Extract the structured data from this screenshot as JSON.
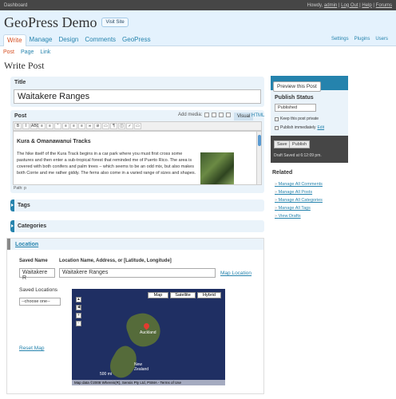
{
  "topbar": {
    "left": "Dashboard",
    "howdy": "Howdy,",
    "user": "admin",
    "links": [
      "Log Out",
      "Help",
      "Forums"
    ]
  },
  "header": {
    "site_title": "GeoPress Demo",
    "visit_site": "Visit Site"
  },
  "menu": {
    "main": [
      "Write",
      "Manage",
      "Design",
      "Comments",
      "GeoPress"
    ],
    "secondary": [
      "Settings",
      "Plugins",
      "Users"
    ]
  },
  "submenu": [
    "Post",
    "Page",
    "Link"
  ],
  "page_title": "Write Post",
  "title_box": {
    "label": "Title",
    "value": "Waitakere Ranges"
  },
  "post_box": {
    "label": "Post",
    "add_media": "Add media:",
    "tab_visual": "Visual",
    "tab_html": "HTML",
    "toolbar": [
      "B",
      "I",
      "ABC",
      "≡",
      "≡",
      "“",
      "≡",
      "≡",
      "≡",
      "∞",
      "⊘",
      "▭",
      "¶",
      "◫",
      "✓",
      "▭"
    ],
    "heading": "Kura & Omanawanui Tracks",
    "body": "The hike itself of the Kura Track begins in a car park where you must first cross some pastures and then enter a sub-tropical forest that reminded me of Puerto Rico. The area is covered with both conifers and palm trees – which seems to be an odd mix, but also makes both Corrie and me rather giddy. The ferns also come in a varied range of sizes and shapes.",
    "path": "Path: p"
  },
  "boxes": {
    "tags": "Tags",
    "categories": "Categories"
  },
  "location": {
    "title": "Location",
    "saved_name_label": "Saved Name",
    "location_label": "Location Name, Address, or [Latitude, Longitude]",
    "saved_name_value": "Waitakere R",
    "location_value": "Waitakere Ranges",
    "map_location": "Map Location",
    "saved_locations_label": "Saved Locations",
    "choose_option": "--choose one--",
    "reset_map": "Reset Map",
    "map": {
      "btn_map": "Map",
      "btn_satellite": "Satellite",
      "btn_hybrid": "Hybrid",
      "label_auckland": "Auckland",
      "label_new_zealand": "New\nZealand",
      "scale": "500 mi",
      "footer": "Map data ©2008 Whereis(R), Sensis Pty Ltd, PSMA - Terms of Use"
    }
  },
  "publish": {
    "preview": "Preview this Post",
    "status_label": "Publish Status",
    "status_value": "Published",
    "keep_private": "Keep this post private",
    "publish_immediately": "Publish immediately",
    "edit": "Edit",
    "save": "Save",
    "publish": "Publish",
    "draft_saved": "Draft Saved at 6:12:09 pm."
  },
  "related": {
    "title": "Related",
    "links": [
      "Manage All Comments",
      "Manage All Posts",
      "Manage All Categories",
      "Manage All Tags",
      "View Drafts"
    ]
  }
}
